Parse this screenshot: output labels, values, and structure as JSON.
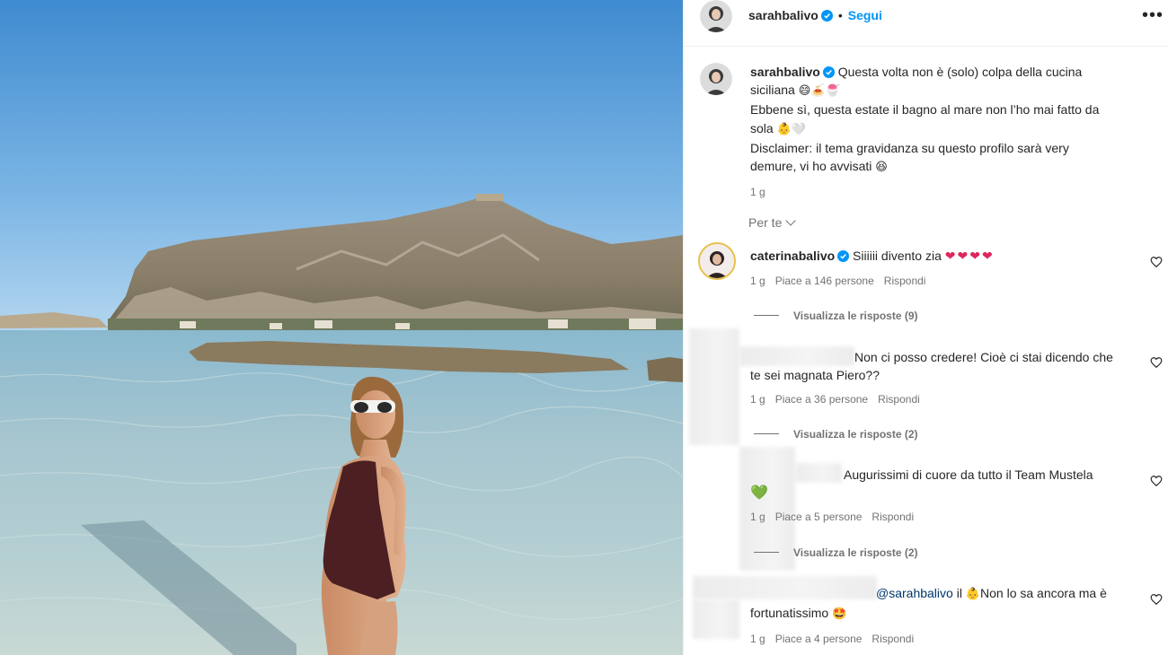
{
  "header": {
    "username": "sarahbalivo",
    "separator": "•",
    "follow_label": "Segui",
    "more_label": "•••"
  },
  "post": {
    "author": "sarahbalivo",
    "line1": "Questa volta non è (solo) colpa della cucina",
    "line2": "siciliana",
    "line2_emoji": "😄🍝🍧",
    "line3": "Ebbene sì, questa estate il bagno al mare non l’ho mai fatto da",
    "line4": "sola",
    "line4_emoji": "👶🤍",
    "line5": "Disclaimer: il tema gravidanza su questo profilo sarà very",
    "line6": "demure, vi ho avvisati",
    "line6_emoji": "😆",
    "time": "1 g"
  },
  "filter": {
    "label": "Per te"
  },
  "comments": [
    {
      "username": "caterinabalivo",
      "text": "Siiiiii divento zia",
      "emoji": "❤❤❤❤",
      "time": "1 g",
      "likes": "Piace a 146 persone",
      "reply": "Rispondi",
      "view_replies": "Visualizza le risposte (9)"
    },
    {
      "text_l1": "Non ci posso credere! Cioè ci stai dicendo che",
      "text_l2": "te sei magnata Piero??",
      "time": "1 g",
      "likes": "Piace a 36 persone",
      "reply": "Rispondi",
      "view_replies": "Visualizza le risposte (2)"
    },
    {
      "text_l1": "Augurissimi di cuore da tutto il Team Mustela",
      "emoji": "💚",
      "time": "1 g",
      "likes": "Piace a 5 persone",
      "reply": "Rispondi",
      "view_replies": "Visualizza le risposte (2)"
    },
    {
      "mention": "@sarahbalivo",
      "text_pre": "il",
      "emoji_mid": "👶",
      "text_l1": "Non lo sa ancora ma è",
      "text_l2": "fortunatissimo",
      "emoji_end": "🤩",
      "time": "1 g",
      "likes": "Piace a 4 persone",
      "reply": "Rispondi"
    }
  ],
  "icons": {
    "verified": "verified-badge-icon",
    "like": "heart-outline-icon",
    "more": "more-options-icon"
  },
  "colors": {
    "follow": "#0095f6",
    "muted": "#737373",
    "verified": "#0095f6",
    "mention": "#00376b"
  }
}
